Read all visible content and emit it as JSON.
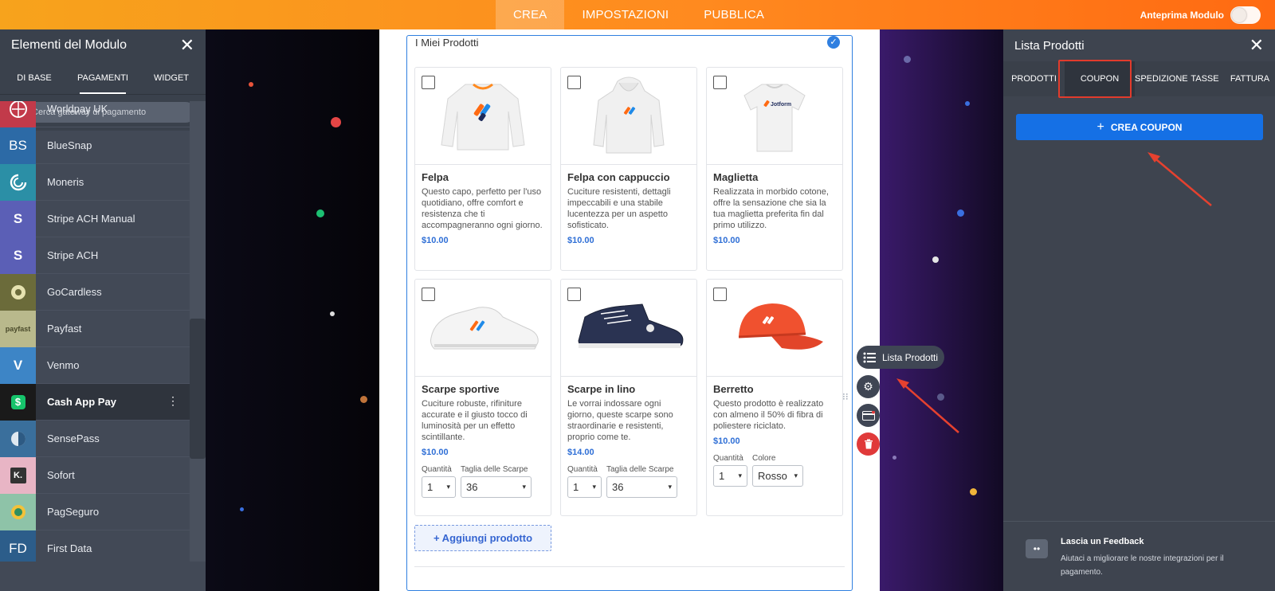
{
  "topbar": {
    "tabs": [
      {
        "label": "CREA"
      },
      {
        "label": "IMPOSTAZIONI"
      },
      {
        "label": "PUBBLICA"
      }
    ],
    "preview_label": "Anteprima Modulo",
    "accent": "#ff8a1f"
  },
  "left_panel": {
    "title": "Elementi del Modulo",
    "tabs": [
      {
        "label": "DI BASE"
      },
      {
        "label": "PAGAMENTI"
      },
      {
        "label": "WIDGET"
      }
    ],
    "search_placeholder": "Cerca gateway di pagamento",
    "items": [
      {
        "label": "Worldpay UK",
        "icon": "worldpay-icon",
        "color": "#c23a4a"
      },
      {
        "label": "BlueSnap",
        "icon": "bluesnap-icon",
        "glyph": "BS",
        "color": "#2c6aa6"
      },
      {
        "label": "Moneris",
        "icon": "moneris-icon",
        "color": "#2b8fa6"
      },
      {
        "label": "Stripe ACH Manual",
        "icon": "stripe-ach-manual-icon",
        "glyph": "S",
        "color": "#5b5fb6"
      },
      {
        "label": "Stripe ACH",
        "icon": "stripe-ach-icon",
        "glyph": "S",
        "color": "#5b5fb6"
      },
      {
        "label": "GoCardless",
        "icon": "gocardless-icon",
        "color": "#6b6b3a"
      },
      {
        "label": "Payfast",
        "icon": "payfast-icon",
        "glyph": "payfast",
        "color": "#b9b98c"
      },
      {
        "label": "Venmo",
        "icon": "venmo-icon",
        "glyph": "V",
        "color": "#3d85c6"
      },
      {
        "label": "Cash App Pay",
        "icon": "cash-app-icon",
        "glyph": "$",
        "color": "#1a1a1a"
      },
      {
        "label": "SensePass",
        "icon": "sensepass-icon",
        "color": "#3a6f9c"
      },
      {
        "label": "Sofort",
        "icon": "sofort-icon",
        "glyph": "K.",
        "color": "#e8b5c5"
      },
      {
        "label": "PagSeguro",
        "icon": "pagseguro-icon",
        "color": "#8ec3a8"
      },
      {
        "label": "First Data",
        "icon": "first-data-icon",
        "glyph": "FD",
        "color": "#2c5d8a"
      }
    ]
  },
  "widget": {
    "title": "I Miei Prodotti",
    "products": [
      {
        "name": "Felpa",
        "desc": "Questo capo, perfetto per l'uso quotidiano, offre comfort e resistenza che ti accompagneranno ogni giorno.",
        "price": "$10.00"
      },
      {
        "name": "Felpa con cappuccio",
        "desc": "Cuciture resistenti, dettagli impeccabili e una stabile lucentezza per un aspetto sofisticato.",
        "price": "$10.00"
      },
      {
        "name": "Maglietta",
        "desc": "Realizzata in morbido cotone, offre la sensazione che sia la tua maglietta preferita fin dal primo utilizzo.",
        "price": "$10.00"
      },
      {
        "name": "Scarpe sportive",
        "desc": "Cuciture robuste, rifiniture accurate e il giusto tocco di luminosità per un effetto scintillante.",
        "price": "$10.00",
        "opt1_label": "Quantità",
        "opt1_value": "1",
        "opt2_label": "Taglia delle Scarpe",
        "opt2_value": "36"
      },
      {
        "name": "Scarpe in lino",
        "desc": "Le vorrai indossare ogni giorno, queste scarpe sono straordinarie e resistenti, proprio come te.",
        "price": "$14.00",
        "opt1_label": "Quantità",
        "opt1_value": "1",
        "opt2_label": "Taglia delle Scarpe",
        "opt2_value": "36"
      },
      {
        "name": "Berretto",
        "desc": "Questo prodotto è realizzato con almeno il 50% di fibra di poliestere riciclato.",
        "price": "$10.00",
        "opt1_label": "Quantità",
        "opt1_value": "1",
        "opt2_label": "Colore",
        "opt2_value": "Rosso"
      }
    ],
    "add_label": "+ Aggiungi prodotto"
  },
  "floating": {
    "lista_label": "Lista Prodotti"
  },
  "right_panel": {
    "title": "Lista Prodotti",
    "tabs": [
      {
        "label": "PRODOTTI"
      },
      {
        "label": "COUPON"
      },
      {
        "label": "SPEDIZIONE"
      },
      {
        "label": "TASSE"
      },
      {
        "label": "FATTURA"
      }
    ],
    "create_label": "CREA COUPON",
    "feedback_title": "Lascia un Feedback",
    "feedback_desc": "Aiutaci a migliorare le nostre integrazioni per il pagamento."
  }
}
